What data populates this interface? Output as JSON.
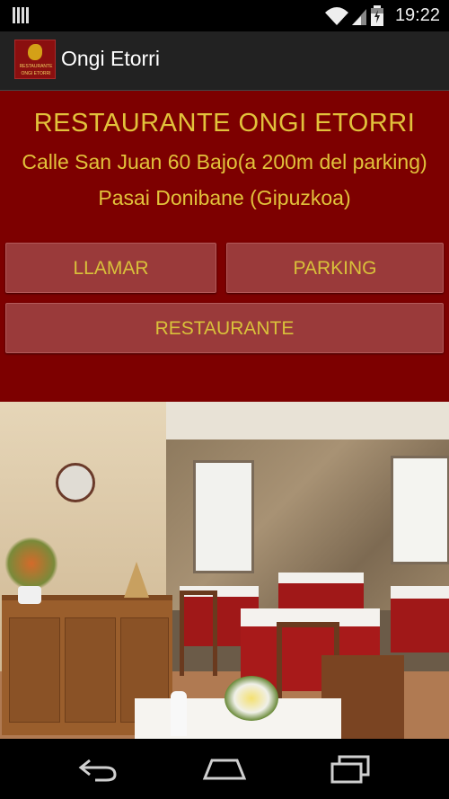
{
  "status_bar": {
    "time": "19:22",
    "icons": [
      "notification-icon",
      "wifi-icon",
      "signal-icon",
      "battery-icon"
    ]
  },
  "action_bar": {
    "app_title": "Ongi Etorri",
    "logo": {
      "line1": "RESTAURANTE",
      "line2": "ONGI ETORRI"
    }
  },
  "header": {
    "restaurant_name": "RESTAURANTE ONGI ETORRI",
    "address_line1": "Calle San Juan 60 Bajo(a 200m del parking)",
    "address_line2": "Pasai Donibane (Gipuzkoa)"
  },
  "buttons": {
    "call": "LLAMAR",
    "parking": "PARKING",
    "restaurant": "RESTAURANTE"
  },
  "navigation": [
    "back-icon",
    "home-icon",
    "recent-apps-icon"
  ],
  "colors": {
    "panel_bg": "#7d0000",
    "text_gold": "#e2c23b",
    "button_bg": "#9a3a3a",
    "action_bar_bg": "#222222"
  }
}
